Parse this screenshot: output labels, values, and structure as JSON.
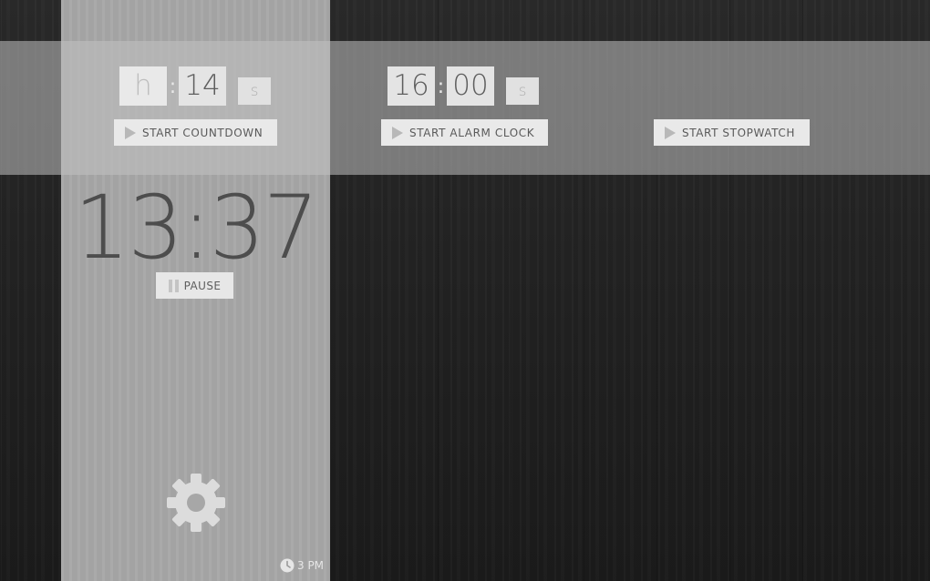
{
  "countdown": {
    "hours_placeholder": "h",
    "minutes_value": "14",
    "seconds_placeholder": "s",
    "separator": ":",
    "button_label": "START  COUNTDOWN"
  },
  "alarm": {
    "hours_value": "16",
    "minutes_value": "00",
    "seconds_placeholder": "s",
    "separator": ":",
    "button_label": "START  ALARM CLOCK"
  },
  "stopwatch": {
    "button_label": "START  STOPWATCH"
  },
  "timer_display": {
    "value": "13:37",
    "pause_label": "PAUSE"
  },
  "status": {
    "time_label": "3 PM"
  },
  "icons": {
    "play": "play-icon",
    "pause": "pause-icon",
    "settings": "gear-icon",
    "clock": "clock-icon"
  }
}
